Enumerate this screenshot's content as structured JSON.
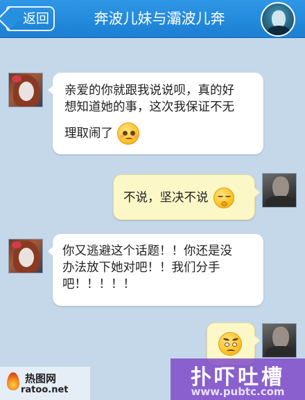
{
  "header": {
    "back_label": "返回",
    "title": "奔波儿妹与灞波儿奔"
  },
  "messages": [
    {
      "sender": "her",
      "side": "left",
      "lines": [
        "亲爱的你就跟我说说呗，真的好",
        "想知道她的事，这次我保证不无",
        "理取闹了"
      ],
      "emoji": "pleading-face-icon"
    },
    {
      "sender": "him",
      "side": "right",
      "lines": [
        "不说，坚决不说"
      ],
      "emoji": "shushing-face-icon"
    },
    {
      "sender": "her",
      "side": "left",
      "lines": [
        "你又逃避这个话题！！你还是没",
        "办法放下她对吧！！我们分手",
        "吧！！！！！"
      ],
      "emoji": null
    },
    {
      "sender": "him",
      "side": "right",
      "lines": [],
      "emoji": "frowning-face-icon"
    }
  ],
  "watermarks": {
    "left_name": "热图网",
    "left_url": "ratoo.net",
    "right_brand": "扑吓吐槽",
    "right_url": "www.pubtc.com"
  },
  "colors": {
    "header": "#1b7fd2",
    "background": "#c5d8ea",
    "bubble_left": "#ffffff",
    "bubble_right": "#fbf7c6",
    "watermark_purple": "#7c46c8"
  }
}
